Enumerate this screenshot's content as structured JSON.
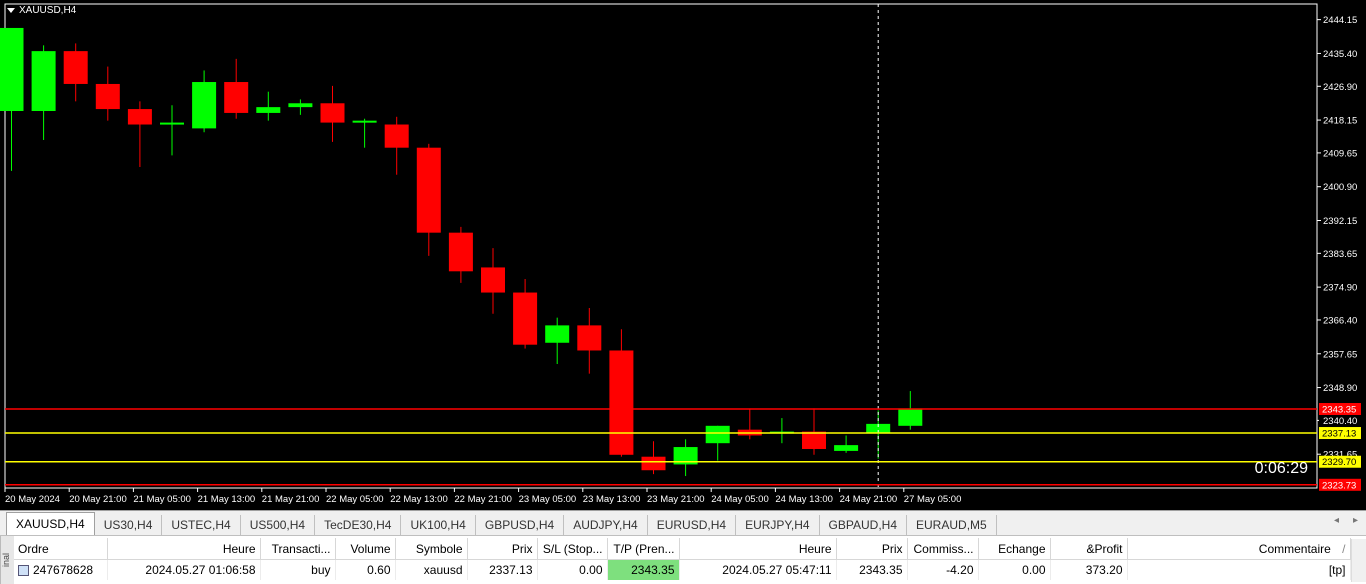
{
  "chart": {
    "symbol_label": "XAUUSD,H4",
    "countdown": "0:06:29",
    "colors": {
      "bull": "#00ff00",
      "bear": "#ff0000",
      "sl_line": "#ff0000",
      "tp_line": "#ffff00",
      "background": "#000000",
      "foreground": "#ffffff"
    },
    "price_axis": [
      "2444.15",
      "2435.40",
      "2426.90",
      "2418.15",
      "2409.65",
      "2400.90",
      "2392.15",
      "2383.65",
      "2374.90",
      "2366.40",
      "2357.65",
      "2348.90",
      "2340.40",
      "2331.65"
    ],
    "price_range": [
      2322.9,
      2448.2
    ],
    "time_axis": [
      "20 May 2024",
      "20 May 21:00",
      "21 May 05:00",
      "21 May 13:00",
      "21 May 21:00",
      "22 May 05:00",
      "22 May 13:00",
      "22 May 21:00",
      "23 May 05:00",
      "23 May 13:00",
      "23 May 21:00",
      "24 May 05:00",
      "24 May 13:00",
      "24 May 21:00",
      "27 May 05:00"
    ],
    "markers": [
      {
        "price": "2343.35",
        "value": 2343.35,
        "color": "#ff0000",
        "text": "#ffffff"
      },
      {
        "price": "2337.13",
        "value": 2337.13,
        "color": "#ffff00",
        "text": "#000000"
      },
      {
        "price": "2329.70",
        "value": 2329.7,
        "color": "#ffff00",
        "text": "#000000"
      },
      {
        "price": "2323.73",
        "value": 2323.73,
        "color": "#ff0000",
        "text": "#ffffff"
      }
    ],
    "current_price": {
      "price": "2340.40",
      "value": 2340.4
    },
    "candles": [
      {
        "o": 2420.5,
        "h": 2442.0,
        "l": 2405.0,
        "c": 2442.0
      },
      {
        "o": 2420.5,
        "h": 2437.5,
        "l": 2413.0,
        "c": 2436.0
      },
      {
        "o": 2436.0,
        "h": 2438.0,
        "l": 2423.0,
        "c": 2427.5
      },
      {
        "o": 2427.5,
        "h": 2432.0,
        "l": 2418.0,
        "c": 2421.0
      },
      {
        "o": 2421.0,
        "h": 2423.0,
        "l": 2406.0,
        "c": 2417.0
      },
      {
        "o": 2417.0,
        "h": 2422.0,
        "l": 2409.0,
        "c": 2417.5
      },
      {
        "o": 2416.0,
        "h": 2431.0,
        "l": 2415.0,
        "c": 2428.0
      },
      {
        "o": 2428.0,
        "h": 2434.0,
        "l": 2418.5,
        "c": 2420.0
      },
      {
        "o": 2420.0,
        "h": 2425.5,
        "l": 2418.0,
        "c": 2421.5
      },
      {
        "o": 2421.5,
        "h": 2423.5,
        "l": 2419.5,
        "c": 2422.5
      },
      {
        "o": 2422.5,
        "h": 2427.0,
        "l": 2412.5,
        "c": 2417.5
      },
      {
        "o": 2417.5,
        "h": 2418.5,
        "l": 2411.0,
        "c": 2418.0
      },
      {
        "o": 2417.0,
        "h": 2419.0,
        "l": 2404.0,
        "c": 2411.0
      },
      {
        "o": 2411.0,
        "h": 2412.0,
        "l": 2383.0,
        "c": 2389.0
      },
      {
        "o": 2389.0,
        "h": 2390.5,
        "l": 2376.0,
        "c": 2379.0
      },
      {
        "o": 2380.0,
        "h": 2385.0,
        "l": 2368.0,
        "c": 2373.5
      },
      {
        "o": 2373.5,
        "h": 2377.0,
        "l": 2359.0,
        "c": 2360.0
      },
      {
        "o": 2360.5,
        "h": 2367.0,
        "l": 2355.0,
        "c": 2365.0
      },
      {
        "o": 2365.0,
        "h": 2369.5,
        "l": 2352.5,
        "c": 2358.5
      },
      {
        "o": 2358.5,
        "h": 2364.0,
        "l": 2331.0,
        "c": 2331.5
      },
      {
        "o": 2331.0,
        "h": 2335.0,
        "l": 2326.5,
        "c": 2327.5
      },
      {
        "o": 2329.0,
        "h": 2335.5,
        "l": 2326.0,
        "c": 2333.5
      },
      {
        "o": 2334.5,
        "h": 2339.0,
        "l": 2330.0,
        "c": 2339.0
      },
      {
        "o": 2338.0,
        "h": 2343.5,
        "l": 2335.5,
        "c": 2336.5
      },
      {
        "o": 2337.0,
        "h": 2341.0,
        "l": 2334.5,
        "c": 2337.5
      },
      {
        "o": 2337.5,
        "h": 2343.5,
        "l": 2331.5,
        "c": 2333.0
      },
      {
        "o": 2332.5,
        "h": 2336.5,
        "l": 2332.0,
        "c": 2334.0
      },
      {
        "o": 2337.0,
        "h": 2343.0,
        "l": 2330.5,
        "c": 2339.5
      },
      {
        "o": 2339.0,
        "h": 2348.0,
        "l": 2338.0,
        "c": 2343.5
      }
    ]
  },
  "symbol_tabs": [
    "XAUUSD,H4",
    "US30,H4",
    "USTEC,H4",
    "US500,H4",
    "TecDE30,H4",
    "UK100,H4",
    "GBPUSD,H4",
    "AUDJPY,H4",
    "EURUSD,H4",
    "EURJPY,H4",
    "GBPAUD,H4",
    "EURAUD,M5"
  ],
  "tab_nav": {
    "prev": "◂",
    "next": "▸"
  },
  "terminal": {
    "side_label": "inal",
    "columns": [
      "Ordre",
      "Heure",
      "Transacti...",
      "Volume",
      "Symbole",
      "Prix",
      "S/L (Stop...",
      "T/P (Pren...",
      "Heure",
      "Prix",
      "Commiss...",
      "Echange",
      "&Profit",
      "Commentaire"
    ],
    "sort_mark": "/",
    "row": {
      "ordre": "247678628",
      "heure": "2024.05.27 01:06:58",
      "transaction": "buy",
      "volume": "0.60",
      "symbole": "xauusd",
      "prix": "2337.13",
      "sl": "0.00",
      "tp": "2343.35",
      "heure2": "2024.05.27 05:47:11",
      "prix2": "2343.35",
      "commission": "-4.20",
      "echange": "0.00",
      "profit": "373.20",
      "commentaire": "[tp]"
    }
  }
}
